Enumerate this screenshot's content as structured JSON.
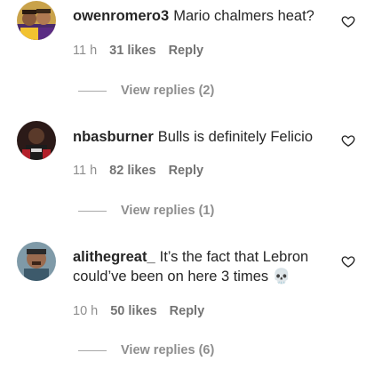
{
  "comments": [
    {
      "username": "owenromero3",
      "text": "Mario chalmers heat?",
      "time": "11 h",
      "likes": "31 likes",
      "reply": "Reply",
      "view_replies": "View replies (2)"
    },
    {
      "username": "nbasburner",
      "text": "Bulls is definitely Felicio",
      "time": "11 h",
      "likes": "82 likes",
      "reply": "Reply",
      "view_replies": "View replies (1)"
    },
    {
      "username": "alithegreat_",
      "text": "It’s the fact that Lebron could’ve been on here 3 times",
      "emoji": "💀",
      "time": "10 h",
      "likes": "50 likes",
      "reply": "Reply",
      "view_replies": "View replies (6)"
    }
  ],
  "icons": {
    "like": "heart-outline-icon"
  }
}
